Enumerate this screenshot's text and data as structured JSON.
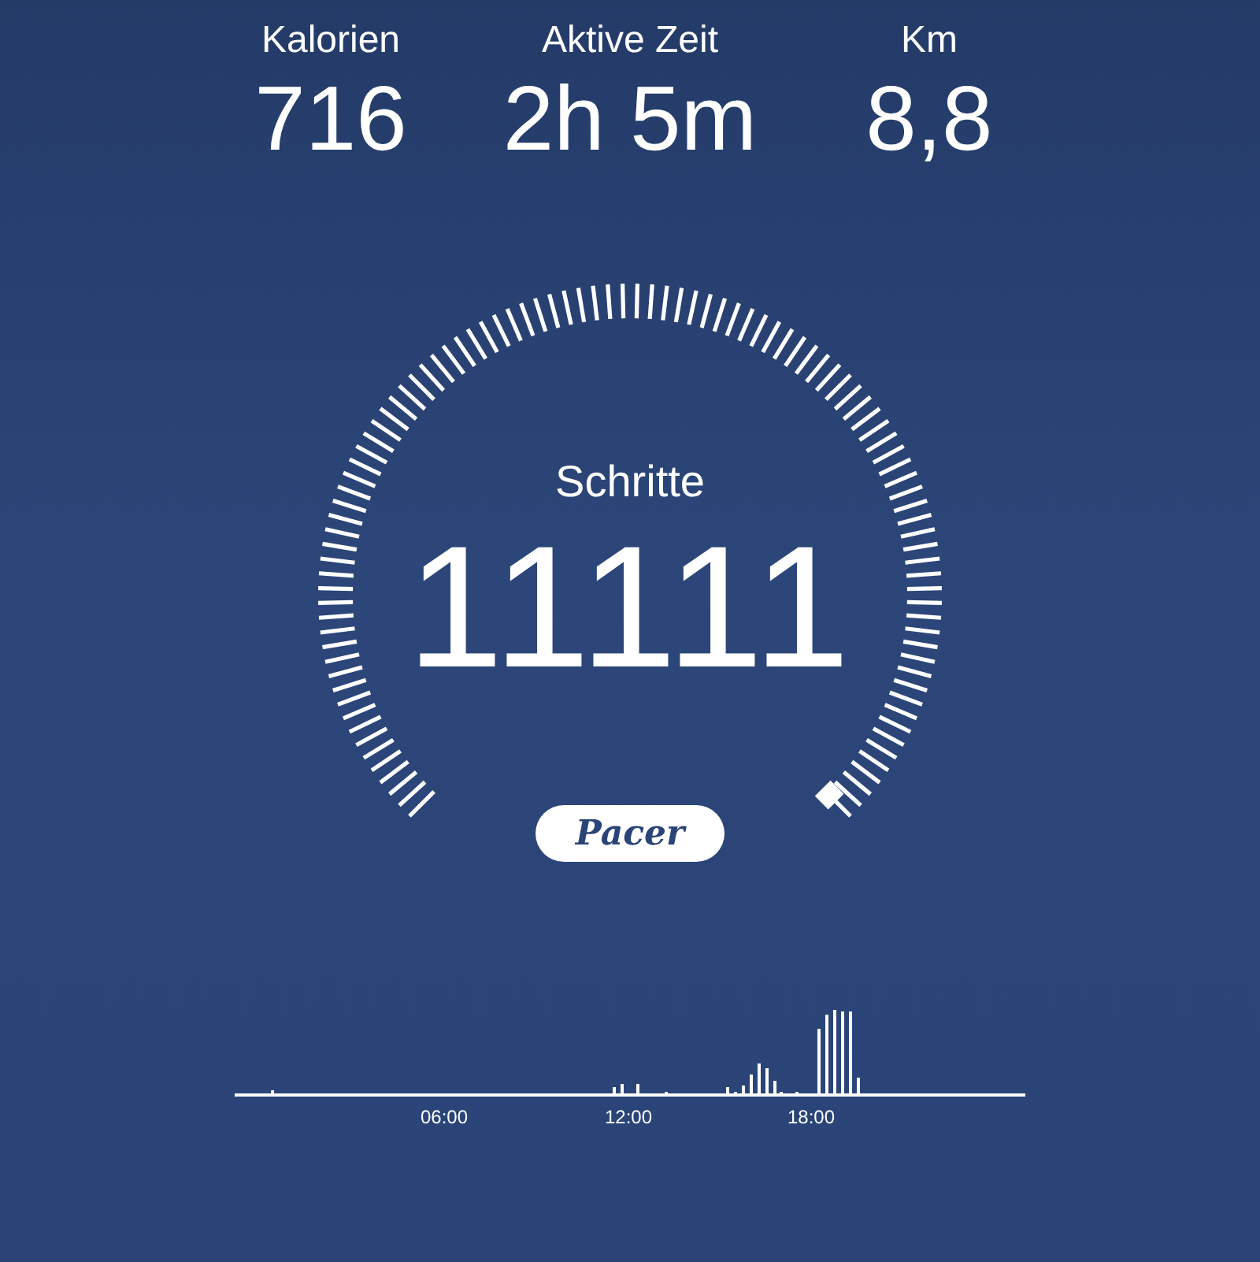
{
  "stats": [
    {
      "label": "Kalorien",
      "value": "716"
    },
    {
      "label": "Aktive Zeit",
      "value": "2h 5m"
    },
    {
      "label": "Km",
      "value": "8,8"
    }
  ],
  "steps": {
    "label": "Schritte",
    "value": "11111"
  },
  "logo": {
    "text": "Pacer"
  },
  "activity": {
    "labels": [
      "06:00",
      "12:00",
      "18:00"
    ]
  }
}
